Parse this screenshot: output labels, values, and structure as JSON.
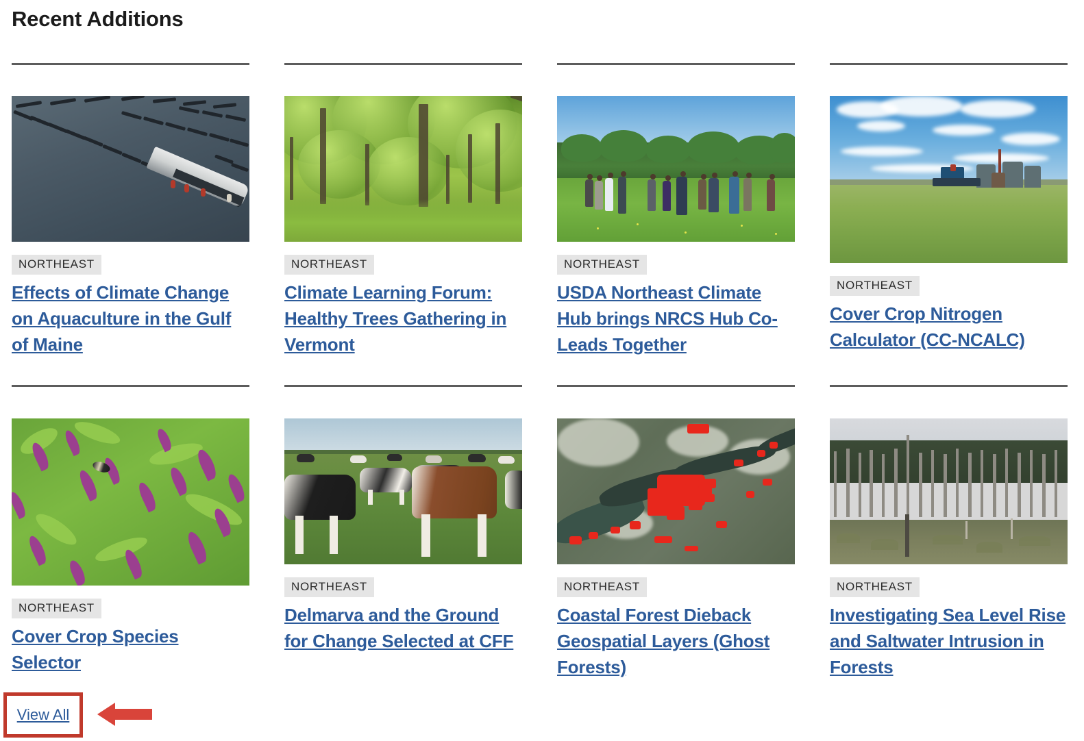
{
  "header": {
    "title": "Recent Additions"
  },
  "footer": {
    "view_all_label": "View All"
  },
  "annotation": {
    "box_color": "#c0392b",
    "arrow_color": "#d9443a",
    "target": "View All"
  },
  "theme": {
    "link_color": "#2d5b9a",
    "tag_background": "#e5e5e5",
    "tag_text_color": "#2b2b2b",
    "rule_color": "#5c5c5c",
    "title_color": "#1b1b1b"
  },
  "cards": [
    {
      "tag": "NORTHEAST",
      "title": "Effects of Climate Change on Aquaculture in the Gulf of Maine",
      "image_name": "aerial-aquaculture-rafts-photo"
    },
    {
      "tag": "NORTHEAST",
      "title": "Climate Learning Forum: Healthy Trees Gathering in Vermont",
      "image_name": "green-deciduous-forest-photo"
    },
    {
      "tag": "NORTHEAST",
      "title": "USDA Northeast Climate Hub brings NRCS Hub Co-Leads Together",
      "image_name": "group-standing-in-green-field-photo"
    },
    {
      "tag": "NORTHEAST",
      "title": "Cover Crop Nitrogen Calculator (CC-NCALC)",
      "image_name": "tractor-in-cover-crop-field-photo"
    },
    {
      "tag": "NORTHEAST",
      "title": "Cover Crop Species Selector",
      "image_name": "purple-vetch-flowers-with-bee-photo"
    },
    {
      "tag": "NORTHEAST",
      "title": "Delmarva and the Ground for Change Selected at CFF",
      "image_name": "dairy-cows-on-pasture-photo"
    },
    {
      "tag": "NORTHEAST",
      "title": "Coastal Forest Dieback Geospatial Layers (Ghost Forests)",
      "image_name": "satellite-dieback-map-photo"
    },
    {
      "tag": "NORTHEAST",
      "title": "Investigating Sea Level Rise and Saltwater Intrusion in Forests",
      "image_name": "ghost-forest-dead-trees-photo"
    }
  ]
}
